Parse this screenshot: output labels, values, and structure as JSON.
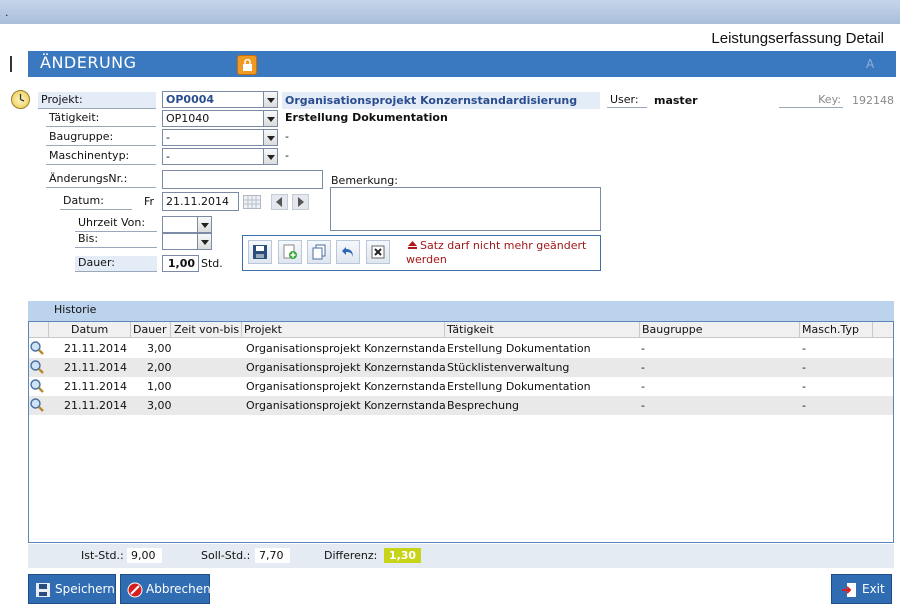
{
  "header": {
    "window_title": "Leistungserfassung Detail",
    "mode_title": "ÄNDERUNG",
    "corner_letter": "A"
  },
  "form": {
    "projekt_label": "Projekt:",
    "projekt_value": "OP0004",
    "projekt_desc": "Organisationsprojekt Konzernstandardisierung",
    "user_label": "User:",
    "user_value": "master",
    "key_label": "Key:",
    "key_value": "192148",
    "taetigkeit_label": "Tätigkeit:",
    "taetigkeit_value": "OP1040",
    "taetigkeit_desc": "Erstellung Dokumentation",
    "baugruppe_label": "Baugruppe:",
    "baugruppe_value": "-",
    "baugruppe_desc": "-",
    "maschinentyp_label": "Maschinentyp:",
    "maschinentyp_value": "-",
    "maschinentyp_desc": "-",
    "aenderungsnr_label": "ÄnderungsNr.:",
    "aenderungsnr_value": "",
    "bemerkung_label": "Bemerkung:",
    "bemerkung_value": "",
    "datum_label": "Datum:",
    "weekday": "Fr",
    "datum_value": "21.11.2014",
    "uhrzeit_von_label": "Uhrzeit Von:",
    "bis_label": "Bis:",
    "dauer_label": "Dauer:",
    "dauer_value": "1,00",
    "dauer_unit": "Std.",
    "warning": "Satz darf nicht mehr geändert werden"
  },
  "historie": {
    "title": "Historie",
    "columns": [
      "Datum",
      "Dauer",
      "Zeit von-bis",
      "Projekt",
      "Tätigkeit",
      "Baugruppe",
      "Masch.Typ"
    ],
    "rows": [
      {
        "datum": "21.11.2014",
        "dauer": "3,00",
        "zeit": "",
        "projekt": "Organisationsprojekt Konzernstanda",
        "taetigkeit": "Erstellung Dokumentation",
        "baugruppe": "-",
        "maschtyp": "-"
      },
      {
        "datum": "21.11.2014",
        "dauer": "2,00",
        "zeit": "",
        "projekt": "Organisationsprojekt Konzernstanda",
        "taetigkeit": "Stücklistenverwaltung",
        "baugruppe": "-",
        "maschtyp": "-"
      },
      {
        "datum": "21.11.2014",
        "dauer": "1,00",
        "zeit": "",
        "projekt": "Organisationsprojekt Konzernstanda",
        "taetigkeit": "Erstellung Dokumentation",
        "baugruppe": "-",
        "maschtyp": "-"
      },
      {
        "datum": "21.11.2014",
        "dauer": "3,00",
        "zeit": "",
        "projekt": "Organisationsprojekt Konzernstanda",
        "taetigkeit": "Besprechung",
        "baugruppe": "-",
        "maschtyp": "-"
      }
    ]
  },
  "summary": {
    "ist_label": "Ist-Std.:",
    "ist_value": "9,00",
    "soll_label": "Soll-Std.:",
    "soll_value": "7,70",
    "diff_label": "Differenz:",
    "diff_value": "1,30"
  },
  "buttons": {
    "save": "Speichern",
    "cancel": "Abbrechen",
    "exit": "Exit"
  },
  "colors": {
    "header_blue": "#3a78bf",
    "label_bg": "#e4ecf7",
    "warning_red": "#a01818",
    "diff_yellow": "#c8d41a"
  }
}
